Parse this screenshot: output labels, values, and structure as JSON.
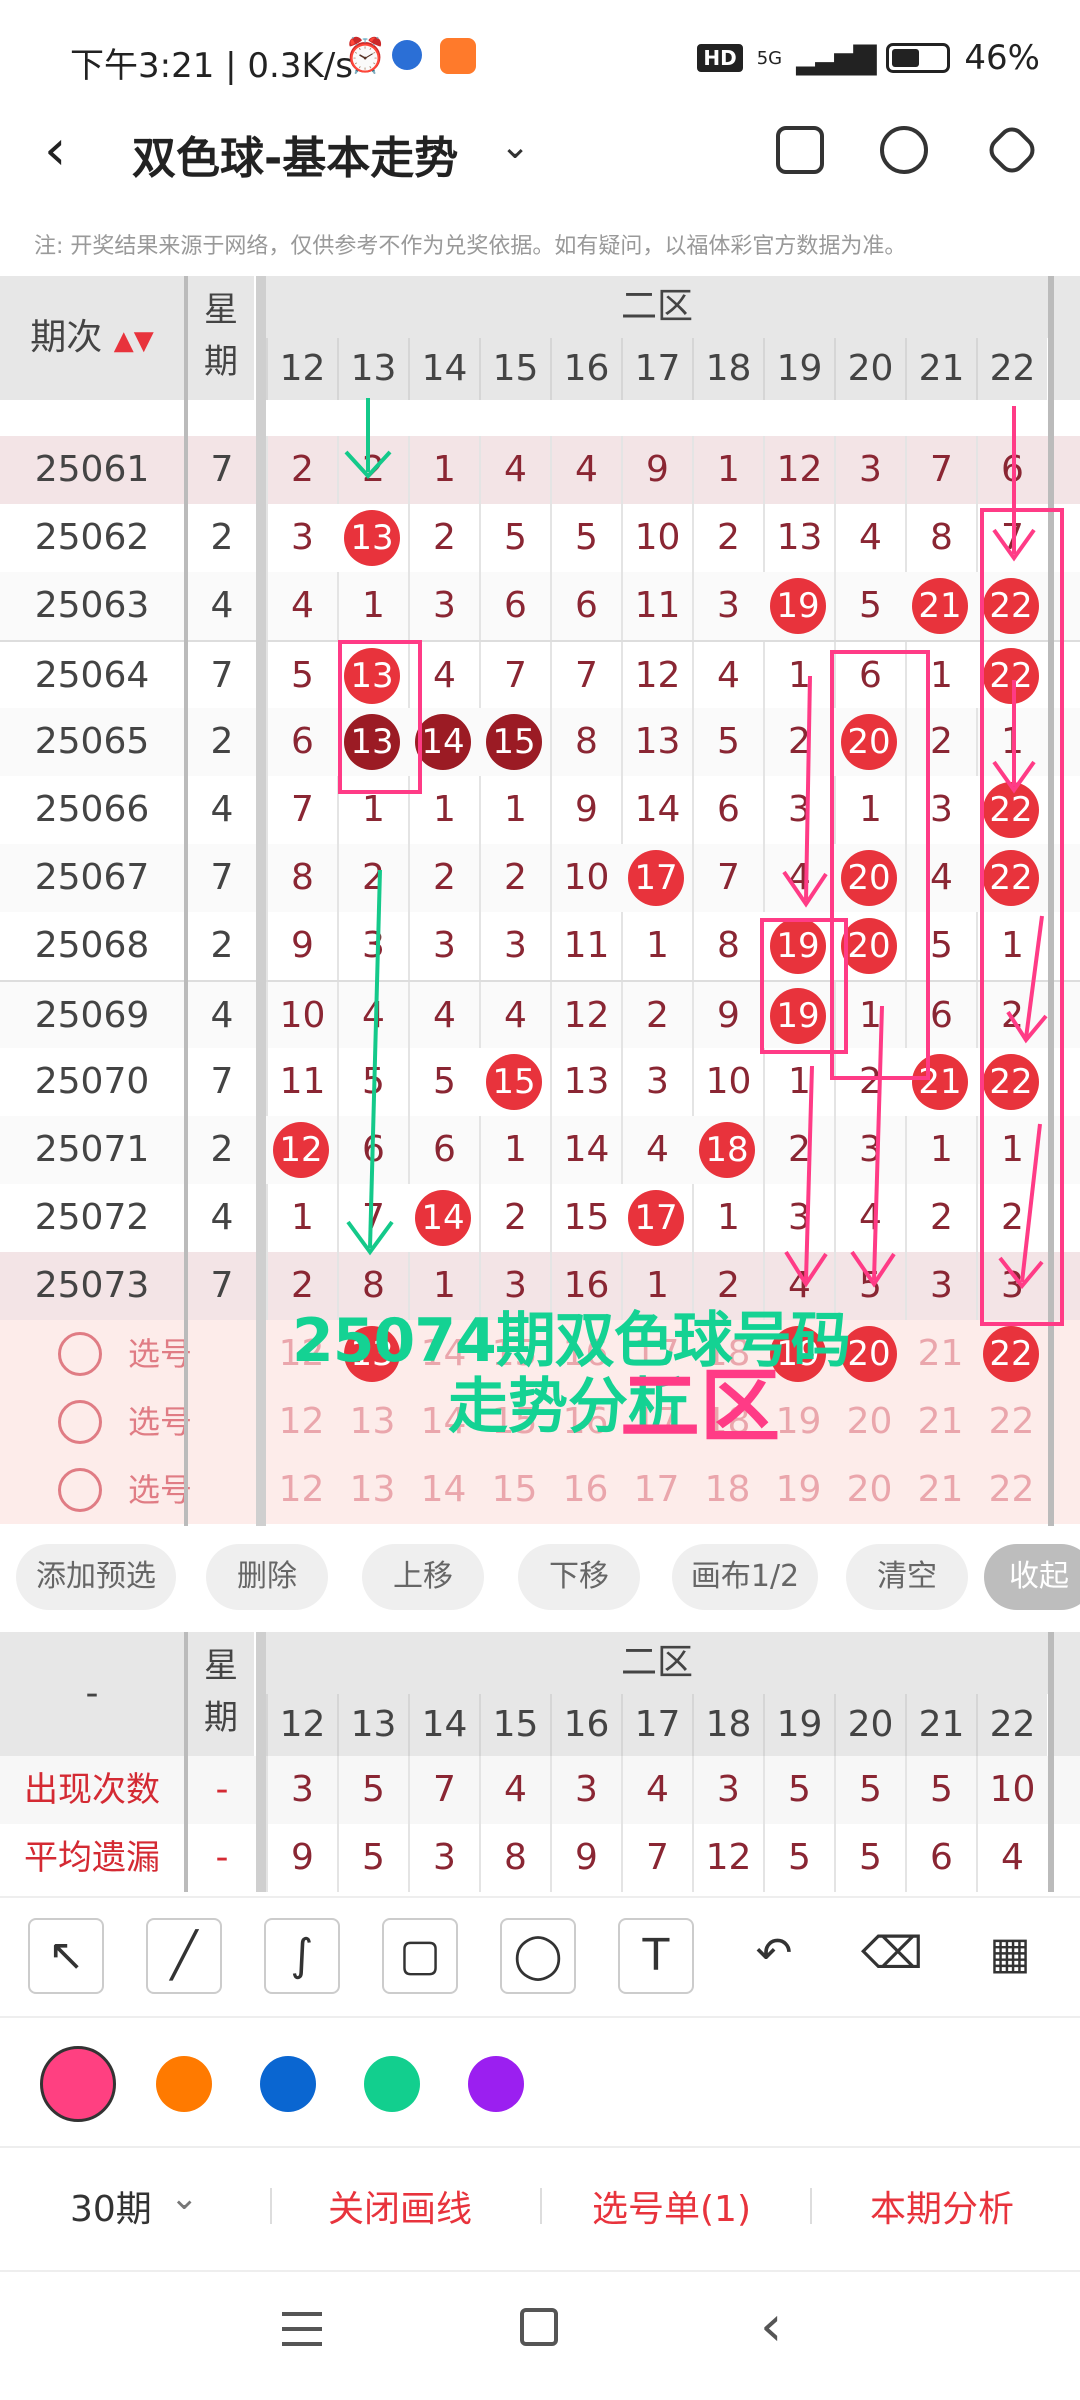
{
  "status_bar": {
    "time": "下午3:21 | 0.3K/s",
    "hd": "HD",
    "network": "5G",
    "battery": "46%"
  },
  "title_bar": {
    "back_icon": "chevron-left-icon",
    "title": "双色球-基本走势",
    "dropdown_icon": "chevron-down-icon",
    "icons": [
      "phone-layout-icon",
      "share-icon",
      "settings-icon"
    ]
  },
  "notice": "注: 开奖结果来源于网络，仅供参考不作为兑奖依据。如有疑问，以福体彩官方数据为准。",
  "table": {
    "header_period": "期次",
    "header_week": "星期",
    "zone_label": "二区",
    "columns": [
      "12",
      "13",
      "14",
      "15",
      "16",
      "17",
      "18",
      "19",
      "20",
      "21",
      "22"
    ],
    "rows": [
      {
        "period": "25061",
        "week": "7",
        "cells": [
          "2",
          "2",
          "1",
          "4",
          "4",
          "9",
          "1",
          "12",
          "3",
          "7",
          "6"
        ],
        "balls": []
      },
      {
        "period": "25062",
        "week": "2",
        "cells": [
          "3",
          "13",
          "2",
          "5",
          "5",
          "10",
          "2",
          "13",
          "4",
          "8",
          "7"
        ],
        "balls": [
          1
        ]
      },
      {
        "period": "25063",
        "week": "4",
        "cells": [
          "4",
          "1",
          "3",
          "6",
          "6",
          "11",
          "3",
          "19",
          "5",
          "21",
          "22"
        ],
        "balls": [
          7,
          9,
          10
        ]
      },
      {
        "period": "25064",
        "week": "7",
        "cells": [
          "5",
          "13",
          "4",
          "7",
          "7",
          "12",
          "4",
          "1",
          "6",
          "1",
          "22"
        ],
        "balls": [
          1,
          10
        ]
      },
      {
        "period": "25065",
        "week": "2",
        "cells": [
          "6",
          "13",
          "14",
          "15",
          "8",
          "13",
          "5",
          "2",
          "20",
          "2",
          "1"
        ],
        "balls": [
          1,
          2,
          3,
          8
        ],
        "dark": [
          1,
          2,
          3
        ]
      },
      {
        "period": "25066",
        "week": "4",
        "cells": [
          "7",
          "1",
          "1",
          "1",
          "9",
          "14",
          "6",
          "3",
          "1",
          "3",
          "22"
        ],
        "balls": [
          10
        ]
      },
      {
        "period": "25067",
        "week": "7",
        "cells": [
          "8",
          "2",
          "2",
          "2",
          "10",
          "17",
          "7",
          "4",
          "20",
          "4",
          "22"
        ],
        "balls": [
          5,
          8,
          10
        ]
      },
      {
        "period": "25068",
        "week": "2",
        "cells": [
          "9",
          "3",
          "3",
          "3",
          "11",
          "1",
          "8",
          "19",
          "20",
          "5",
          "1"
        ],
        "balls": [
          7,
          8
        ]
      },
      {
        "period": "25069",
        "week": "4",
        "cells": [
          "10",
          "4",
          "4",
          "4",
          "12",
          "2",
          "9",
          "19",
          "1",
          "6",
          "2"
        ],
        "balls": [
          7
        ]
      },
      {
        "period": "25070",
        "week": "7",
        "cells": [
          "11",
          "5",
          "5",
          "15",
          "13",
          "3",
          "10",
          "1",
          "2",
          "21",
          "22"
        ],
        "balls": [
          3,
          9,
          10
        ]
      },
      {
        "period": "25071",
        "week": "2",
        "cells": [
          "12",
          "6",
          "6",
          "1",
          "14",
          "4",
          "18",
          "2",
          "3",
          "1",
          "1"
        ],
        "balls": [
          0,
          6
        ]
      },
      {
        "period": "25072",
        "week": "4",
        "cells": [
          "1",
          "7",
          "14",
          "2",
          "15",
          "17",
          "1",
          "3",
          "4",
          "2",
          "2"
        ],
        "balls": [
          2,
          5
        ]
      },
      {
        "period": "25073",
        "week": "7",
        "cells": [
          "2",
          "8",
          "1",
          "3",
          "16",
          "1",
          "2",
          "4",
          "5",
          "3",
          "3"
        ],
        "balls": []
      }
    ],
    "select_rows": [
      {
        "label": "选号",
        "cells": [
          "12",
          "13",
          "14",
          "15",
          "16",
          "17",
          "18",
          "19",
          "20",
          "21",
          "22"
        ],
        "balls": [
          1,
          7,
          8,
          10
        ]
      },
      {
        "label": "选号",
        "cells": [
          "12",
          "13",
          "14",
          "15",
          "16",
          "17",
          "18",
          "19",
          "20",
          "21",
          "22"
        ],
        "balls": []
      },
      {
        "label": "选号",
        "cells": [
          "12",
          "13",
          "14",
          "15",
          "16",
          "17",
          "18",
          "19",
          "20",
          "21",
          "22"
        ],
        "balls": []
      }
    ],
    "overlay_line1": "25074期双色球号码",
    "overlay_line2": "走势分析",
    "overlay_zone": "二区"
  },
  "chips": [
    "添加预选",
    "删除",
    "上移",
    "下移",
    "画布1/2",
    "清空",
    "收起"
  ],
  "stats": {
    "header_dash": "-",
    "header_week": "星期",
    "zone_label": "二区",
    "columns": [
      "12",
      "13",
      "14",
      "15",
      "16",
      "17",
      "18",
      "19",
      "20",
      "21",
      "22"
    ],
    "rows": [
      {
        "label": "出现次数",
        "week": "-",
        "values": [
          "3",
          "5",
          "7",
          "4",
          "3",
          "4",
          "3",
          "5",
          "5",
          "5",
          "10"
        ]
      },
      {
        "label": "平均遗漏",
        "week": "-",
        "values": [
          "9",
          "5",
          "3",
          "8",
          "9",
          "7",
          "12",
          "5",
          "5",
          "6",
          "4"
        ]
      }
    ]
  },
  "draw_tools": [
    "arrow-tool-icon",
    "line-tool-icon",
    "curve-tool-icon",
    "rect-tool-icon",
    "circle-tool-icon",
    "text-tool-icon",
    "undo-icon",
    "eraser-icon",
    "clear-brush-icon"
  ],
  "colors": [
    "#ff4081",
    "#ff7a00",
    "#0a66d1",
    "#12cf8e",
    "#9b1ff0"
  ],
  "bottom_bar": {
    "periods": "30期",
    "close_lines": "关闭画线",
    "pick_list": "选号单(1)",
    "analysis": "本期分析"
  },
  "nav": [
    "menu-icon",
    "home-icon",
    "back-icon"
  ]
}
